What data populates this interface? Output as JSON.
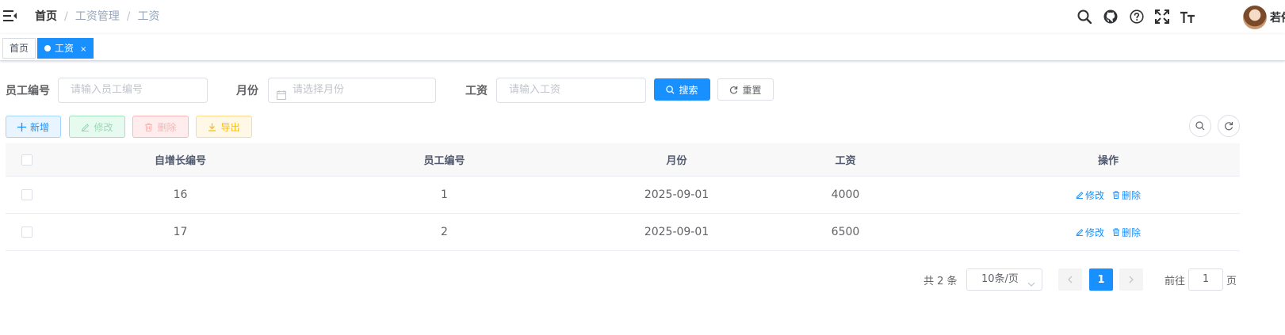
{
  "breadcrumb": [
    "首页",
    "工资管理",
    "工资"
  ],
  "tags": [
    {
      "label": "首页",
      "active": false
    },
    {
      "label": "工资",
      "active": true,
      "close": "×"
    }
  ],
  "user": {
    "name": "若依"
  },
  "search": {
    "fields": [
      {
        "label": "员工编号",
        "placeholder": "请输入员工编号"
      },
      {
        "label": "月份",
        "placeholder": "请选择月份"
      },
      {
        "label": "工资",
        "placeholder": "请输入工资"
      }
    ],
    "search_label": "搜索",
    "reset_label": "重置"
  },
  "toolbar": {
    "add_label": "新增",
    "edit_label": "修改",
    "delete_label": "删除",
    "export_label": "导出"
  },
  "table": {
    "columns": [
      "自增长编号",
      "员工编号",
      "月份",
      "工资",
      "操作"
    ],
    "rows": [
      {
        "id": "16",
        "emp_no": "1",
        "month": "2025-09-01",
        "salary": "4000",
        "edit": "修改",
        "delete": "删除"
      },
      {
        "id": "17",
        "emp_no": "2",
        "month": "2025-09-01",
        "salary": "6500",
        "edit": "修改",
        "delete": "删除"
      }
    ]
  },
  "pagination": {
    "total_text": "共 2 条",
    "page_size": "10条/页",
    "current_page": "1",
    "goto_label": "前往",
    "goto_value": "1",
    "page_suffix": "页"
  },
  "colors": {
    "primary": "#1890ff",
    "success": "#13ce66",
    "danger": "#ff4949",
    "warning": "#ffba00"
  },
  "icons": [
    "hamburger-icon",
    "search-icon",
    "github-icon",
    "question-icon",
    "fullscreen-icon",
    "font-size-icon",
    "calendar-icon",
    "refresh-icon",
    "plus-icon",
    "edit-icon",
    "delete-icon",
    "download-icon",
    "chevron-down-icon",
    "chevron-left-icon",
    "chevron-right-icon"
  ]
}
